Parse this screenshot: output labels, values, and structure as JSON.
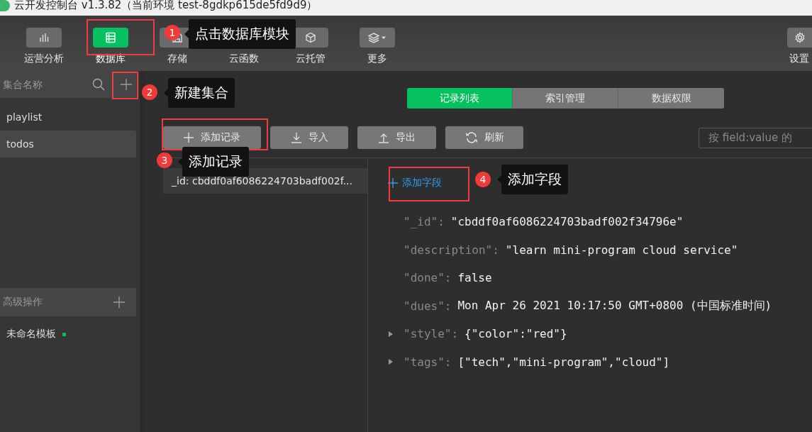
{
  "window": {
    "title": "云开发控制台 v1.3.82（当前环境 test-8gdkp615de5fd9d9）"
  },
  "toolbar": {
    "items": [
      {
        "label": "运营分析",
        "selected": false
      },
      {
        "label": "数据库",
        "selected": true
      },
      {
        "label": "存储",
        "selected": false
      },
      {
        "label": "云函数",
        "selected": false
      },
      {
        "label": "云托管",
        "selected": false
      },
      {
        "label": "更多",
        "selected": false
      }
    ],
    "settings": {
      "label": "设置"
    }
  },
  "sidebar": {
    "search": {
      "placeholder": "集合名称"
    },
    "collections": [
      {
        "name": "playlist",
        "selected": false
      },
      {
        "name": "todos",
        "selected": true
      }
    ],
    "advanced": {
      "title": "高级操作"
    },
    "templates": [
      {
        "name": "未命名模板"
      }
    ]
  },
  "tabs": [
    {
      "label": "记录列表",
      "selected": true
    },
    {
      "label": "索引管理",
      "selected": false
    },
    {
      "label": "数据权限",
      "selected": false
    }
  ],
  "actions": [
    {
      "label": "添加记录"
    },
    {
      "label": "导入"
    },
    {
      "label": "导出"
    },
    {
      "label": "刷新"
    }
  ],
  "search": {
    "placeholder": "按 field:value 的"
  },
  "records": [
    {
      "label": "_id: cbddf0af6086224703badf002f...",
      "selected": true
    }
  ],
  "add_field": {
    "label": "添加字段"
  },
  "fields": [
    {
      "key": "\"_id\":",
      "value": "\"cbddf0af6086224703badf002f34796e\"",
      "expandable": false
    },
    {
      "key": "\"description\":",
      "value": "\"learn mini-program cloud service\"",
      "expandable": false
    },
    {
      "key": "\"done\":",
      "value": "false",
      "expandable": false
    },
    {
      "key": "\"dues\":",
      "value": "Mon Apr 26 2021 10:17:50 GMT+0800 (中国标准时间)",
      "expandable": false
    },
    {
      "key": "\"style\":",
      "value": "{\"color\":\"red\"}",
      "expandable": true
    },
    {
      "key": "\"tags\":",
      "value": "[\"tech\",\"mini-program\",\"cloud\"]",
      "expandable": true
    }
  ],
  "annotations": [
    {
      "number": "1",
      "text": "点击数据库模块"
    },
    {
      "number": "2",
      "text": "新建集合"
    },
    {
      "number": "3",
      "text": "添加记录"
    },
    {
      "number": "4",
      "text": "添加字段"
    }
  ]
}
